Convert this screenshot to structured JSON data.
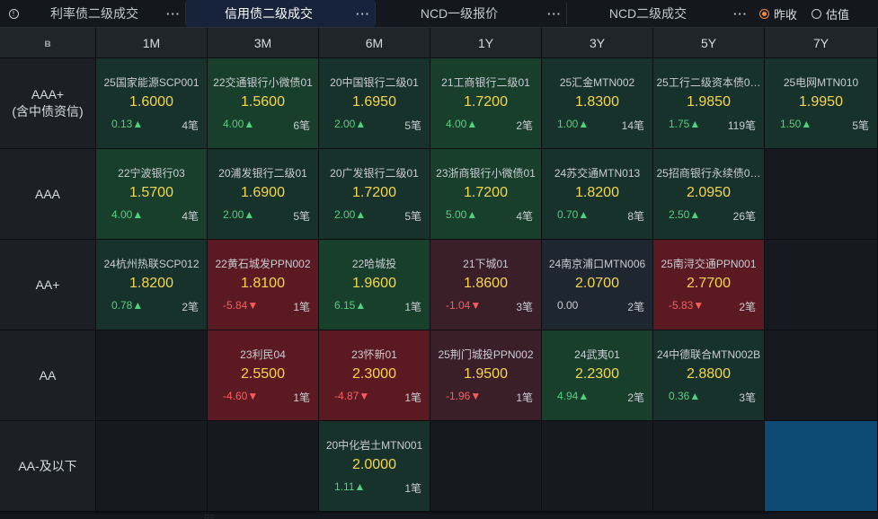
{
  "tabs": [
    {
      "label": "利率债二级成交",
      "more": "···",
      "active": false
    },
    {
      "label": "信用债二级成交",
      "more": "···",
      "active": true
    },
    {
      "label": "NCD一级报价",
      "more": "···",
      "active": false
    },
    {
      "label": "NCD二级成交",
      "more": "···",
      "active": false
    }
  ],
  "info_icon": "info-icon",
  "radios": [
    {
      "label": "昨收",
      "selected": true
    },
    {
      "label": "估值",
      "selected": false
    }
  ],
  "corner": "ȣ",
  "columns": [
    "1M",
    "3M",
    "6M",
    "1Y",
    "3Y",
    "5Y",
    "7Y"
  ],
  "rows": [
    {
      "label1": "AAA+",
      "label2": "(含中债资信)",
      "cells": [
        {
          "style": "gd",
          "name": "25国家能源SCP001",
          "price": "1.6000",
          "change": "0.13▲",
          "dir": "up",
          "count": "4笔"
        },
        {
          "style": "g",
          "name": "22交通银行小微债01",
          "price": "1.5600",
          "change": "4.00▲",
          "dir": "up",
          "count": "6笔"
        },
        {
          "style": "gd",
          "name": "20中国银行二级01",
          "price": "1.6950",
          "change": "2.00▲",
          "dir": "up",
          "count": "5笔"
        },
        {
          "style": "g",
          "name": "21工商银行二级01",
          "price": "1.7200",
          "change": "4.00▲",
          "dir": "up",
          "count": "2笔"
        },
        {
          "style": "gd",
          "name": "25汇金MTN002",
          "price": "1.8300",
          "change": "1.00▲",
          "dir": "up",
          "count": "14笔"
        },
        {
          "style": "gd",
          "name": "25工行二级资本债0…",
          "price": "1.9850",
          "change": "1.75▲",
          "dir": "up",
          "count": "119笔"
        },
        {
          "style": "gd",
          "name": "25电网MTN010",
          "price": "1.9950",
          "change": "1.50▲",
          "dir": "up",
          "count": "5笔"
        }
      ]
    },
    {
      "label1": "AAA",
      "label2": "",
      "cells": [
        {
          "style": "g",
          "name": "22宁波银行03",
          "price": "1.5700",
          "change": "4.00▲",
          "dir": "up",
          "count": "4笔"
        },
        {
          "style": "gd",
          "name": "20浦发银行二级01",
          "price": "1.6900",
          "change": "2.00▲",
          "dir": "up",
          "count": "5笔"
        },
        {
          "style": "gd",
          "name": "20广发银行二级01",
          "price": "1.7200",
          "change": "2.00▲",
          "dir": "up",
          "count": "5笔"
        },
        {
          "style": "g",
          "name": "23浙商银行小微债01",
          "price": "1.7200",
          "change": "5.00▲",
          "dir": "up",
          "count": "4笔"
        },
        {
          "style": "gd",
          "name": "24苏交通MTN013",
          "price": "1.8200",
          "change": "0.70▲",
          "dir": "up",
          "count": "8笔"
        },
        {
          "style": "gd",
          "name": "25招商银行永续债0…",
          "price": "2.0950",
          "change": "2.50▲",
          "dir": "up",
          "count": "26笔"
        },
        {
          "style": "e",
          "name": "",
          "price": "",
          "change": "",
          "dir": "",
          "count": ""
        }
      ]
    },
    {
      "label1": "AA+",
      "label2": "",
      "cells": [
        {
          "style": "gd",
          "name": "24杭州热联SCP012",
          "price": "1.8200",
          "change": "0.78▲",
          "dir": "up",
          "count": "2笔"
        },
        {
          "style": "r",
          "name": "22黄石城发PPN002",
          "price": "1.8100",
          "change": "-5.84▼",
          "dir": "down",
          "count": "1笔"
        },
        {
          "style": "g",
          "name": "22哈城投",
          "price": "1.9600",
          "change": "6.15▲",
          "dir": "up",
          "count": "1笔"
        },
        {
          "style": "rd",
          "name": "21下城01",
          "price": "1.8600",
          "change": "-1.04▼",
          "dir": "down",
          "count": "3笔"
        },
        {
          "style": "n",
          "name": "24南京浦口MTN006",
          "price": "2.0700",
          "change": "0.00",
          "dir": "flat",
          "count": "2笔"
        },
        {
          "style": "r",
          "name": "25南浔交通PPN001",
          "price": "2.7700",
          "change": "-5.83▼",
          "dir": "down",
          "count": "2笔"
        },
        {
          "style": "e",
          "name": "",
          "price": "",
          "change": "",
          "dir": "",
          "count": ""
        }
      ]
    },
    {
      "label1": "AA",
      "label2": "",
      "cells": [
        {
          "style": "e",
          "name": "",
          "price": "",
          "change": "",
          "dir": "",
          "count": ""
        },
        {
          "style": "r",
          "name": "23利民04",
          "price": "2.5500",
          "change": "-4.60▼",
          "dir": "down",
          "count": "1笔"
        },
        {
          "style": "r",
          "name": "23怀新01",
          "price": "2.3000",
          "change": "-4.87▼",
          "dir": "down",
          "count": "1笔"
        },
        {
          "style": "rd",
          "name": "25荆门城投PPN002",
          "price": "1.9500",
          "change": "-1.96▼",
          "dir": "down",
          "count": "1笔"
        },
        {
          "style": "g",
          "name": "24武夷01",
          "price": "2.2300",
          "change": "4.94▲",
          "dir": "up",
          "count": "2笔"
        },
        {
          "style": "gd",
          "name": "24中德联合MTN002B",
          "price": "2.8800",
          "change": "0.36▲",
          "dir": "up",
          "count": "3笔"
        },
        {
          "style": "e",
          "name": "",
          "price": "",
          "change": "",
          "dir": "",
          "count": ""
        }
      ]
    },
    {
      "label1": "AA-及以下",
      "label2": "",
      "cells": [
        {
          "style": "e",
          "name": "",
          "price": "",
          "change": "",
          "dir": "",
          "count": ""
        },
        {
          "style": "e",
          "name": "",
          "price": "",
          "change": "",
          "dir": "",
          "count": ""
        },
        {
          "style": "gd",
          "name": "20中化岩土MTN001",
          "price": "2.0000",
          "change": "1.11▲",
          "dir": "up",
          "count": "1笔"
        },
        {
          "style": "e",
          "name": "",
          "price": "",
          "change": "",
          "dir": "",
          "count": ""
        },
        {
          "style": "e",
          "name": "",
          "price": "",
          "change": "",
          "dir": "",
          "count": ""
        },
        {
          "style": "e",
          "name": "",
          "price": "",
          "change": "",
          "dir": "",
          "count": ""
        },
        {
          "style": "b",
          "name": "",
          "price": "",
          "change": "",
          "dir": "",
          "count": ""
        }
      ]
    }
  ],
  "grip": "::::"
}
